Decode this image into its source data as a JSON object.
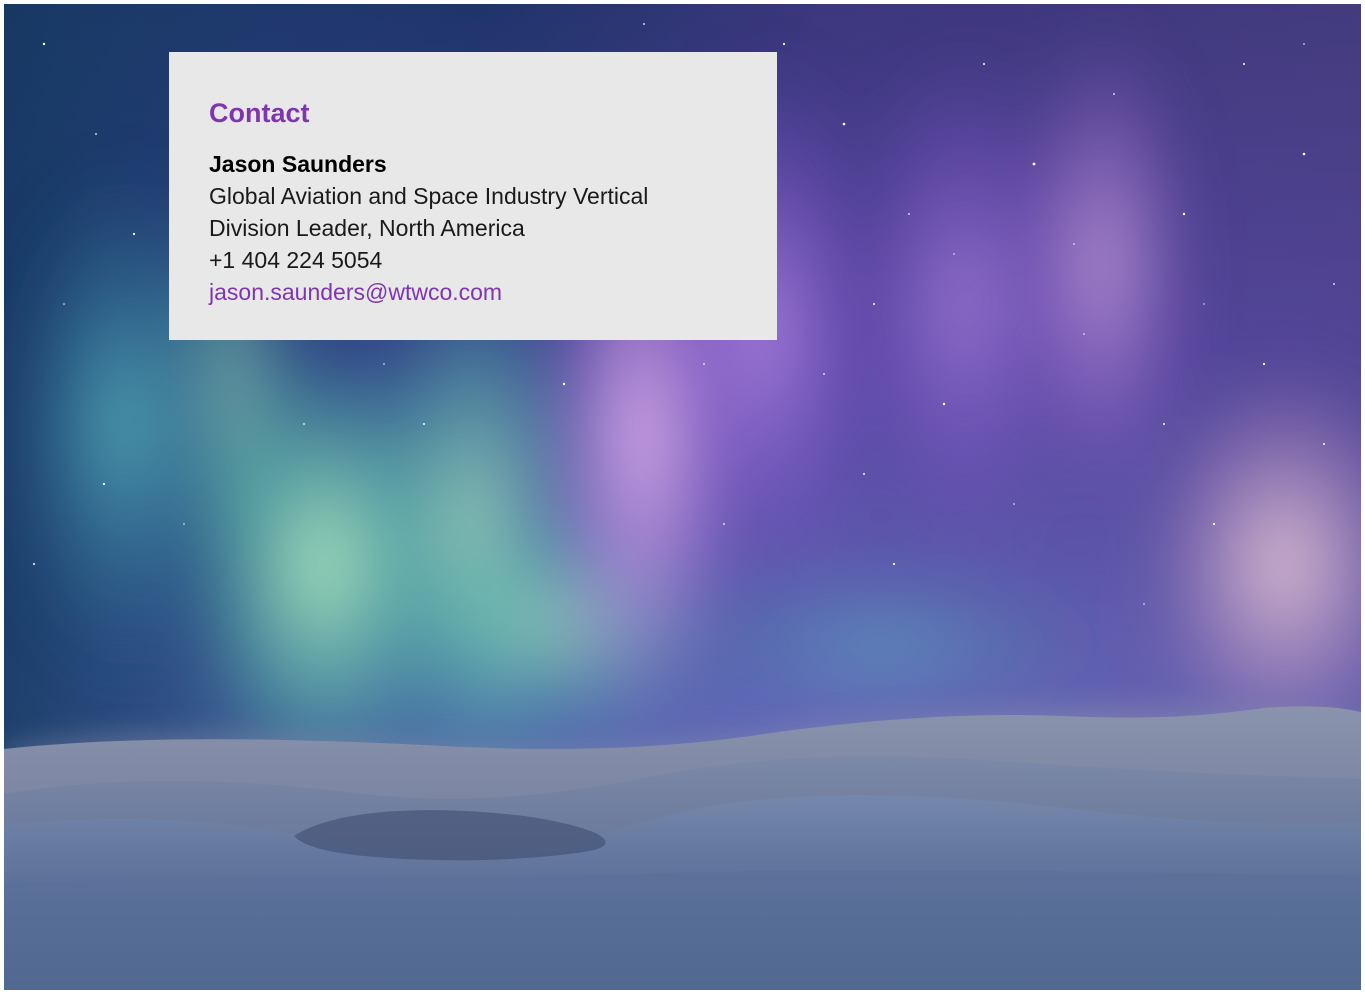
{
  "contact": {
    "heading": "Contact",
    "name": "Jason Saunders",
    "title_line_1": "Global Aviation and Space Industry Vertical",
    "title_line_2": "Division Leader, North America",
    "phone": "+1 404 224 5054",
    "email": "jason.saunders@wtwco.com"
  },
  "colors": {
    "accent": "#7f35b2",
    "card_background": "#e8e8e8",
    "text": "#1a1a1a"
  },
  "background": {
    "scene": "aurora-over-snowy-hills"
  }
}
